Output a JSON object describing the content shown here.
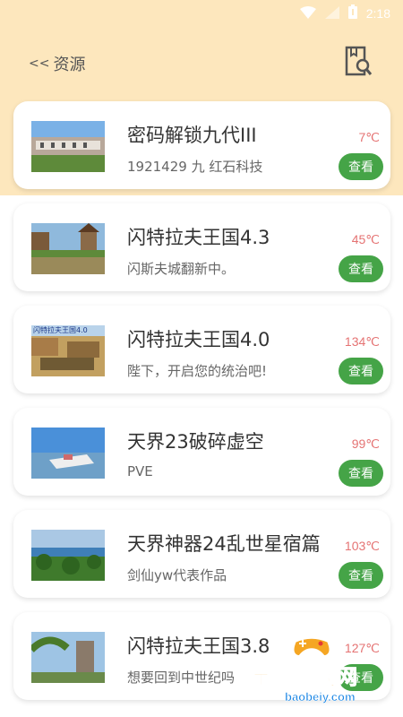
{
  "status_bar": {
    "time": "2:18"
  },
  "header": {
    "back_arrows": "<<",
    "title": "资源"
  },
  "items": [
    {
      "title": "密码解锁九代III",
      "subtitle": "1921429 九 红石科技",
      "temp": "7℃",
      "button": "查看"
    },
    {
      "title": "闪特拉夫王国4.3",
      "subtitle": "闪斯夫城翻新中。",
      "temp": "45℃",
      "button": "查看"
    },
    {
      "title": "闪特拉夫王国4.0",
      "subtitle": "陛下，开启您的统治吧!",
      "temp": "134℃",
      "button": "查看",
      "thumb_caption": "闪特拉夫王国4.0"
    },
    {
      "title": "天界23破碎虚空",
      "subtitle": "PVE",
      "temp": "99℃",
      "button": "查看"
    },
    {
      "title": "天界神器24乱世星宿篇",
      "subtitle": "剑仙yw代表作品",
      "temp": "103℃",
      "button": "查看"
    },
    {
      "title": "闪特拉夫王国3.8",
      "subtitle": "想要回到中世纪吗",
      "temp": "127℃",
      "button": "查看"
    }
  ],
  "watermark": {
    "text": "宝贝游戏网",
    "url": "baobeiy.com"
  },
  "colors": {
    "header_bg": "#fde7bd",
    "button_green": "#45a447",
    "temp_red": "#e57373"
  }
}
